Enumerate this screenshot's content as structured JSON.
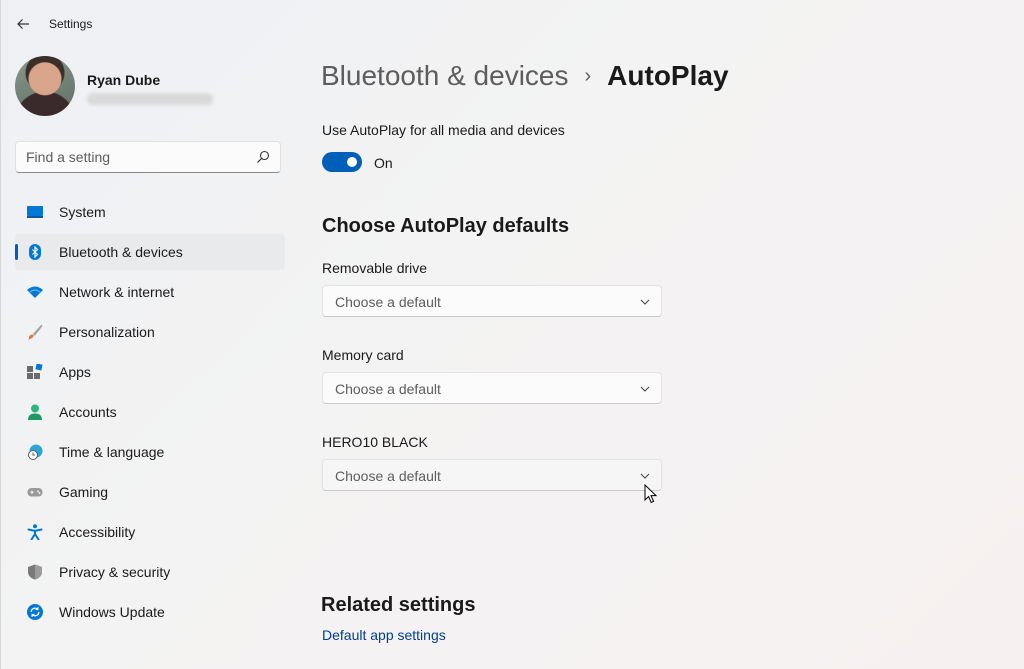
{
  "app": {
    "title": "Settings"
  },
  "profile": {
    "name": "Ryan Dube"
  },
  "search": {
    "placeholder": "Find a setting",
    "value": ""
  },
  "sidebar": {
    "items": [
      {
        "label": "System",
        "icon": "monitor-icon"
      },
      {
        "label": "Bluetooth & devices",
        "icon": "bluetooth-icon",
        "active": true
      },
      {
        "label": "Network & internet",
        "icon": "wifi-icon"
      },
      {
        "label": "Personalization",
        "icon": "brush-icon"
      },
      {
        "label": "Apps",
        "icon": "apps-icon"
      },
      {
        "label": "Accounts",
        "icon": "person-icon"
      },
      {
        "label": "Time & language",
        "icon": "globe-clock-icon"
      },
      {
        "label": "Gaming",
        "icon": "gamepad-icon"
      },
      {
        "label": "Accessibility",
        "icon": "accessibility-icon"
      },
      {
        "label": "Privacy & security",
        "icon": "shield-icon"
      },
      {
        "label": "Windows Update",
        "icon": "update-icon"
      }
    ]
  },
  "breadcrumb": {
    "parent": "Bluetooth & devices",
    "separator": "›",
    "current": "AutoPlay"
  },
  "autoplay_toggle": {
    "label": "Use AutoPlay for all media and devices",
    "state": "On",
    "on": true
  },
  "defaults": {
    "title": "Choose AutoPlay defaults",
    "fields": [
      {
        "label": "Removable drive",
        "value": "Choose a default"
      },
      {
        "label": "Memory card",
        "value": "Choose a default"
      },
      {
        "label": "HERO10 BLACK",
        "value": "Choose a default"
      }
    ]
  },
  "related": {
    "title": "Related settings",
    "link": "Default app settings"
  },
  "colors": {
    "accent": "#005fb8",
    "link": "#003e92"
  }
}
